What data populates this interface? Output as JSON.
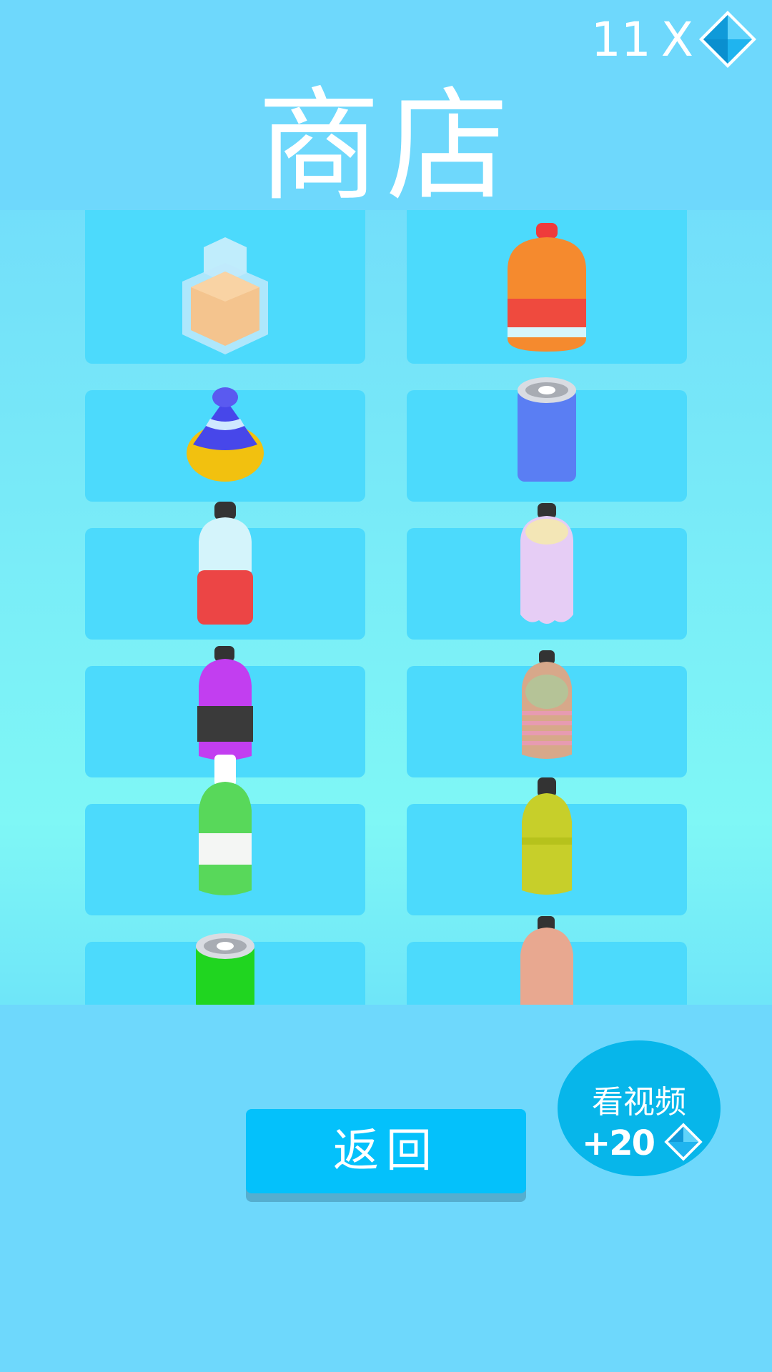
{
  "header": {
    "title": "商店",
    "gem_count": "11",
    "gem_multiplier": "X",
    "gem_icon": "diamond-icon"
  },
  "shop": {
    "items": [
      {
        "name": "perfume-bottle"
      },
      {
        "name": "orange-jug"
      },
      {
        "name": "cone-bottle-blue-yellow"
      },
      {
        "name": "blue-can"
      },
      {
        "name": "water-bottle-red"
      },
      {
        "name": "iridescent-bottle"
      },
      {
        "name": "purple-black-bottle"
      },
      {
        "name": "ribbed-rainbow-bottle"
      },
      {
        "name": "green-white-bottle"
      },
      {
        "name": "yellow-green-bottle"
      },
      {
        "name": "green-can"
      },
      {
        "name": "peach-bottle"
      }
    ]
  },
  "footer": {
    "back_label": "返回",
    "video_label": "看视频",
    "video_reward": "+20",
    "video_reward_icon": "diamond-icon"
  },
  "colors": {
    "background": "#6ed8fc",
    "slot": "#4cdafc",
    "button": "#04c1fb",
    "video_button": "#07b6ea"
  }
}
